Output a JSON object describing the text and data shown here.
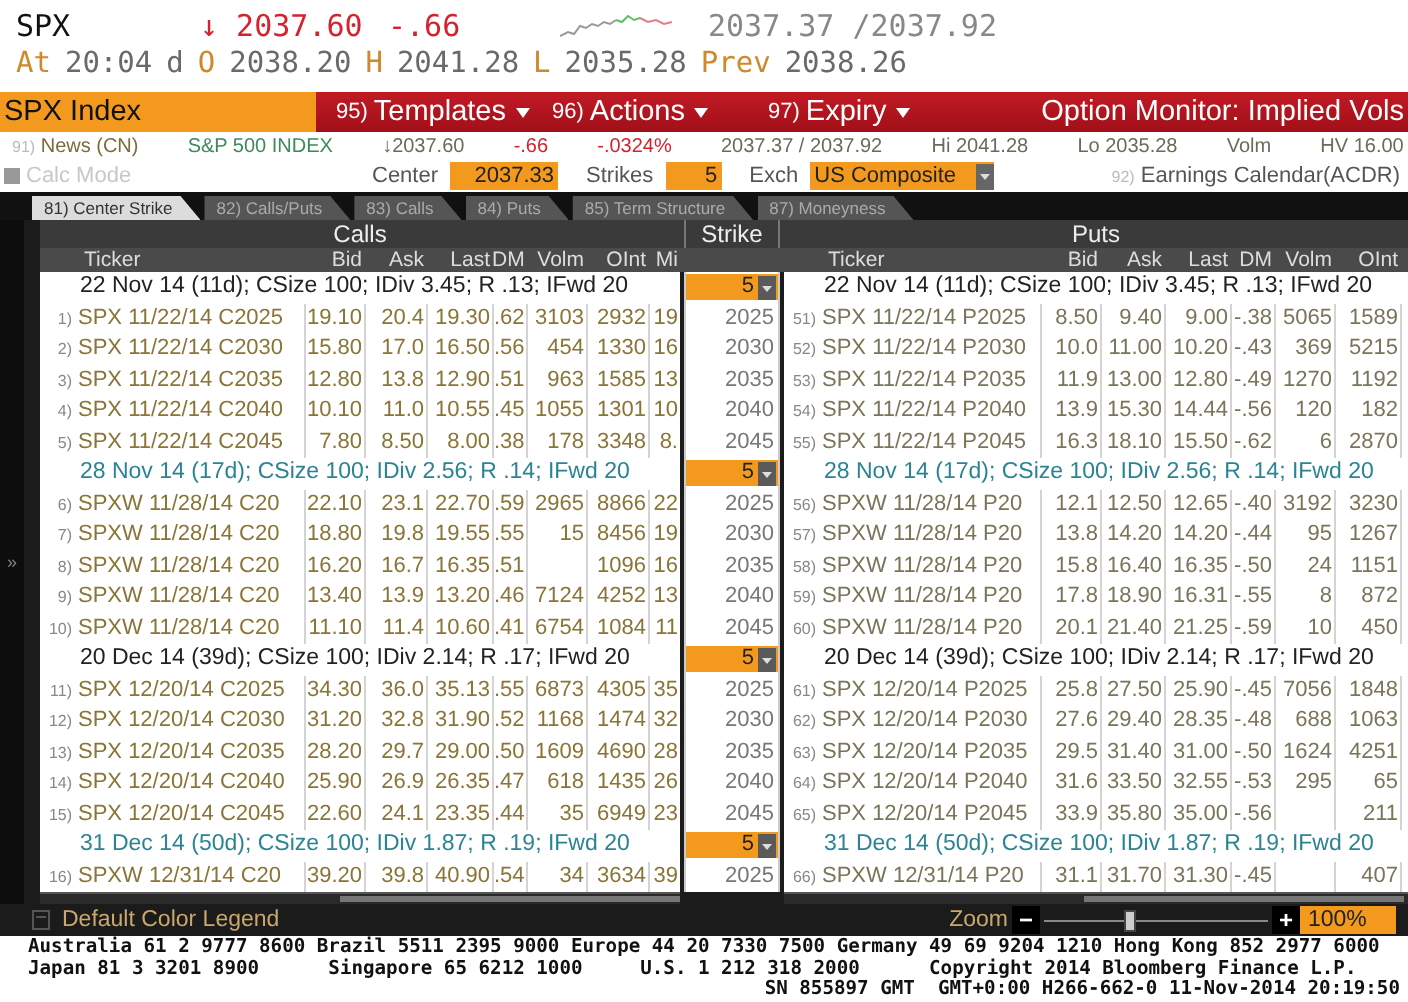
{
  "quote": {
    "symbol": "SPX",
    "price": "↓ 2037.60",
    "change": "-.66",
    "bid_ask": "2037.37 /2037.92",
    "details": [
      {
        "kind": "label",
        "text": "At"
      },
      {
        "kind": "value",
        "text": "20:04"
      },
      {
        "kind": "value",
        "text": "d"
      },
      {
        "kind": "label",
        "text": "O"
      },
      {
        "kind": "value",
        "text": "2038.20"
      },
      {
        "kind": "label",
        "text": "H"
      },
      {
        "kind": "value",
        "text": "2041.28"
      },
      {
        "kind": "label",
        "text": "L"
      },
      {
        "kind": "value",
        "text": "2035.28"
      },
      {
        "kind": "label",
        "text": "Prev"
      },
      {
        "kind": "value",
        "text": "2038.26"
      }
    ]
  },
  "menu_bar": {
    "security": "SPX Index",
    "items": [
      {
        "number": "95)",
        "label": "Templates"
      },
      {
        "number": "96)",
        "label": "Actions"
      },
      {
        "number": "97)",
        "label": "Expiry"
      }
    ],
    "title": "Option Monitor: Implied Vols"
  },
  "info_bar": {
    "news": {
      "number": "91)",
      "label": "News (CN)"
    },
    "name": "S&P 500 INDEX",
    "last": "↓2037.60",
    "change": "-.66",
    "change_pct": "-.0324%",
    "bid_ask": "2037.37 / 2037.92",
    "high": "Hi 2041.28",
    "low": "Lo 2035.28",
    "volume": "Volm",
    "hv": "HV 16.00"
  },
  "controls": {
    "calc_mode": {
      "label": "Calc Mode",
      "disabled": true,
      "checked": false
    },
    "center_label": "Center",
    "center": "2037.33",
    "strikes_label": "Strikes",
    "strikes": "5",
    "exch_label": "Exch",
    "exch": "US Composite",
    "earnings": {
      "number": "92)",
      "label": "Earnings Calendar(ACDR)"
    }
  },
  "tabs": [
    {
      "label": "81) Center Strike",
      "selected": true
    },
    {
      "label": "82) Calls/Puts",
      "selected": false
    },
    {
      "label": "83) Calls",
      "selected": false
    },
    {
      "label": "84) Puts",
      "selected": false
    },
    {
      "label": "85) Term Structure",
      "selected": false
    },
    {
      "label": "87) Moneyness",
      "selected": false
    }
  ],
  "chain": {
    "expand": "»",
    "calls_title": "Calls",
    "strike_title": "Strike",
    "puts_title": "Puts",
    "call_columns": [
      "Ticker",
      "Bid",
      "Ask",
      "Last",
      "DM",
      "Volm",
      "OInt",
      "Mi"
    ],
    "put_columns": [
      "Ticker",
      "Bid",
      "Ask",
      "Last",
      "DM",
      "Volm",
      "OInt"
    ],
    "groups": [
      {
        "label": "22 Nov 14 (11d); CSize 100; IDiv 3.45; R .13; IFwd 20",
        "put_label": "22 Nov 14 (11d); CSize 100; IDiv 3.45; R .13; IFwd 20",
        "color": "#222222",
        "strikes": "5",
        "rows": [
          {
            "strike": "2025",
            "call": {
              "n": "1)",
              "ticker": "SPX 11/22/14 C2025",
              "bid": "19.10",
              "ask": "20.4",
              "last": "19.30",
              "dm": ".62",
              "volm": "3103",
              "oint": "2932",
              "mi": "19"
            },
            "put": {
              "n": "51)",
              "ticker": "SPX 11/22/14 P2025",
              "bid": "8.50",
              "ask": "9.40",
              "last": "9.00",
              "dm": "-.38",
              "volm": "5065",
              "oint": "1589"
            }
          },
          {
            "strike": "2030",
            "call": {
              "n": "2)",
              "ticker": "SPX 11/22/14 C2030",
              "bid": "15.80",
              "ask": "17.0",
              "last": "16.50",
              "dm": ".56",
              "volm": "454",
              "oint": "1330",
              "mi": "16"
            },
            "put": {
              "n": "52)",
              "ticker": "SPX 11/22/14 P2030",
              "bid": "10.0",
              "ask": "11.00",
              "last": "10.20",
              "dm": "-.43",
              "volm": "369",
              "oint": "5215"
            }
          },
          {
            "strike": "2035",
            "call": {
              "n": "3)",
              "ticker": "SPX 11/22/14 C2035",
              "bid": "12.80",
              "ask": "13.8",
              "last": "12.90",
              "dm": ".51",
              "volm": "963",
              "oint": "1585",
              "mi": "13"
            },
            "put": {
              "n": "53)",
              "ticker": "SPX 11/22/14 P2035",
              "bid": "11.9",
              "ask": "13.00",
              "last": "12.80",
              "dm": "-.49",
              "volm": "1270",
              "oint": "1192"
            }
          },
          {
            "strike": "2040",
            "call": {
              "n": "4)",
              "ticker": "SPX 11/22/14 C2040",
              "bid": "10.10",
              "ask": "11.0",
              "last": "10.55",
              "dm": ".45",
              "volm": "1055",
              "oint": "1301",
              "mi": "10"
            },
            "put": {
              "n": "54)",
              "ticker": "SPX 11/22/14 P2040",
              "bid": "13.9",
              "ask": "15.30",
              "last": "14.44",
              "dm": "-.56",
              "volm": "120",
              "oint": "182"
            }
          },
          {
            "strike": "2045",
            "call": {
              "n": "5)",
              "ticker": "SPX 11/22/14 C2045",
              "bid": "7.80",
              "ask": "8.50",
              "last": "8.00",
              "dm": ".38",
              "volm": "178",
              "oint": "3348",
              "mi": "8."
            },
            "put": {
              "n": "55)",
              "ticker": "SPX 11/22/14 P2045",
              "bid": "16.3",
              "ask": "18.10",
              "last": "15.50",
              "dm": "-.62",
              "volm": "6",
              "oint": "2870"
            }
          }
        ]
      },
      {
        "label": "28 Nov 14 (17d); CSize 100; IDiv 2.56; R .14; IFwd 20",
        "put_label": "28 Nov 14 (17d); CSize 100; IDiv 2.56; R .14; IFwd 20",
        "color": "#2a8494",
        "strikes": "5",
        "rows": [
          {
            "strike": "2025",
            "call": {
              "n": "6)",
              "ticker": "SPXW 11/28/14 C20",
              "bid": "22.10",
              "ask": "23.1",
              "last": "22.70",
              "dm": ".59",
              "volm": "2965",
              "oint": "8866",
              "mi": "22"
            },
            "put": {
              "n": "56)",
              "ticker": "SPXW 11/28/14 P20",
              "bid": "12.1",
              "ask": "12.50",
              "last": "12.65",
              "dm": "-.40",
              "volm": "3192",
              "oint": "3230"
            }
          },
          {
            "strike": "2030",
            "call": {
              "n": "7)",
              "ticker": "SPXW 11/28/14 C20",
              "bid": "18.80",
              "ask": "19.8",
              "last": "19.55",
              "dm": ".55",
              "volm": "15",
              "oint": "8456",
              "mi": "19"
            },
            "put": {
              "n": "57)",
              "ticker": "SPXW 11/28/14 P20",
              "bid": "13.8",
              "ask": "14.20",
              "last": "14.20",
              "dm": "-.44",
              "volm": "95",
              "oint": "1267"
            }
          },
          {
            "strike": "2035",
            "call": {
              "n": "8)",
              "ticker": "SPXW 11/28/14 C20",
              "bid": "16.20",
              "ask": "16.7",
              "last": "16.35",
              "dm": ".51",
              "oint": "1096",
              "mi": "16"
            },
            "put": {
              "n": "58)",
              "ticker": "SPXW 11/28/14 P20",
              "bid": "15.8",
              "ask": "16.40",
              "last": "16.35",
              "dm": "-.50",
              "volm": "24",
              "oint": "1151"
            }
          },
          {
            "strike": "2040",
            "call": {
              "n": "9)",
              "ticker": "SPXW 11/28/14 C20",
              "bid": "13.40",
              "ask": "13.9",
              "last": "13.20",
              "dm": ".46",
              "volm": "7124",
              "oint": "4252",
              "mi": "13"
            },
            "put": {
              "n": "59)",
              "ticker": "SPXW 11/28/14 P20",
              "bid": "17.8",
              "ask": "18.90",
              "last": "16.31",
              "dm": "-.55",
              "volm": "8",
              "oint": "872"
            }
          },
          {
            "strike": "2045",
            "call": {
              "n": "10)",
              "ticker": "SPXW 11/28/14 C20",
              "bid": "11.10",
              "ask": "11.4",
              "last": "10.60",
              "dm": ".41",
              "volm": "6754",
              "oint": "1084",
              "mi": "11"
            },
            "put": {
              "n": "60)",
              "ticker": "SPXW 11/28/14 P20",
              "bid": "20.1",
              "ask": "21.40",
              "last": "21.25",
              "dm": "-.59",
              "volm": "10",
              "oint": "450"
            }
          }
        ]
      },
      {
        "label": "20 Dec 14 (39d); CSize 100; IDiv 2.14; R .17; IFwd 20",
        "put_label": "20 Dec 14 (39d); CSize 100; IDiv 2.14; R .17; IFwd 20",
        "color": "#222222",
        "strikes": "5",
        "rows": [
          {
            "strike": "2025",
            "call": {
              "n": "11)",
              "ticker": "SPX 12/20/14 C2025",
              "bid": "34.30",
              "ask": "36.0",
              "last": "35.13",
              "dm": ".55",
              "volm": "6873",
              "oint": "4305",
              "mi": "35"
            },
            "put": {
              "n": "61)",
              "ticker": "SPX 12/20/14 P2025",
              "bid": "25.8",
              "ask": "27.50",
              "last": "25.90",
              "dm": "-.45",
              "volm": "7056",
              "oint": "1848"
            }
          },
          {
            "strike": "2030",
            "call": {
              "n": "12)",
              "ticker": "SPX 12/20/14 C2030",
              "bid": "31.20",
              "ask": "32.8",
              "last": "31.90",
              "dm": ".52",
              "volm": "1168",
              "oint": "1474",
              "mi": "32"
            },
            "put": {
              "n": "62)",
              "ticker": "SPX 12/20/14 P2030",
              "bid": "27.6",
              "ask": "29.40",
              "last": "28.35",
              "dm": "-.48",
              "volm": "688",
              "oint": "1063"
            }
          },
          {
            "strike": "2035",
            "call": {
              "n": "13)",
              "ticker": "SPX 12/20/14 C2035",
              "bid": "28.20",
              "ask": "29.7",
              "last": "29.00",
              "dm": ".50",
              "volm": "1609",
              "oint": "4690",
              "mi": "28"
            },
            "put": {
              "n": "63)",
              "ticker": "SPX 12/20/14 P2035",
              "bid": "29.5",
              "ask": "31.40",
              "last": "31.00",
              "dm": "-.50",
              "volm": "1624",
              "oint": "4251"
            }
          },
          {
            "strike": "2040",
            "call": {
              "n": "14)",
              "ticker": "SPX 12/20/14 C2040",
              "bid": "25.90",
              "ask": "26.9",
              "last": "26.35",
              "dm": ".47",
              "volm": "618",
              "oint": "1435",
              "mi": "26"
            },
            "put": {
              "n": "64)",
              "ticker": "SPX 12/20/14 P2040",
              "bid": "31.6",
              "ask": "33.50",
              "last": "32.55",
              "dm": "-.53",
              "volm": "295",
              "oint": "65"
            }
          },
          {
            "strike": "2045",
            "call": {
              "n": "15)",
              "ticker": "SPX 12/20/14 C2045",
              "bid": "22.60",
              "ask": "24.1",
              "last": "23.35",
              "dm": ".44",
              "volm": "35",
              "oint": "6949",
              "mi": "23"
            },
            "put": {
              "n": "65)",
              "ticker": "SPX 12/20/14 P2045",
              "bid": "33.9",
              "ask": "35.80",
              "last": "35.00",
              "dm": "-.56",
              "oint": "211"
            }
          }
        ]
      },
      {
        "label": "31 Dec 14 (50d); CSize 100; IDiv 1.87; R .19; IFwd 20",
        "put_label": "31 Dec 14 (50d); CSize 100; IDiv 1.87; R .19; IFwd 20",
        "color": "#2a8494",
        "strikes": "5",
        "rows": [
          {
            "strike": "2025",
            "call": {
              "n": "16)",
              "ticker": "SPXW 12/31/14 C20",
              "bid": "39.20",
              "ask": "39.8",
              "last": "40.90",
              "dm": ".54",
              "volm": "34",
              "oint": "3634",
              "mi": "39"
            },
            "put": {
              "n": "66)",
              "ticker": "SPXW 12/31/14 P20",
              "bid": "31.1",
              "ask": "31.70",
              "last": "31.30",
              "dm": "-.45",
              "oint": "407"
            }
          }
        ]
      }
    ]
  },
  "legend_bar": {
    "label": "Default Color Legend",
    "zoom_label": "Zoom",
    "minus": "−",
    "plus": "+",
    "level": 0.38,
    "zoom": "100%"
  },
  "footer": {
    "lines": [
      "Australia 61 2 9777 8600 Brazil 5511 2395 9000 Europe 44 20 7330 7500 Germany 49 69 9204 1210 Hong Kong 852 2977 6000",
      "Japan 81 3 3201 8900      Singapore 65 6212 1000     U.S. 1 212 318 2000      Copyright 2014 Bloomberg Finance L.P."
    ],
    "session": "SN 855897 GMT  GMT+0:00 H266-662-0 11-Nov-2014 20:19:50"
  }
}
